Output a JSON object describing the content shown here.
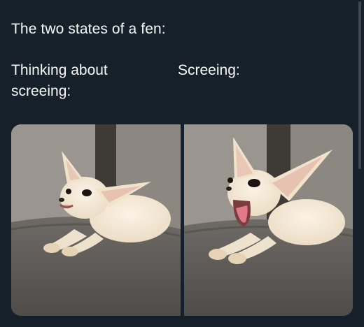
{
  "post": {
    "text": "The two states of a fen:",
    "captions": {
      "left": "Thinking about screeing:",
      "right": "Screeing:"
    }
  },
  "colors": {
    "background": "#15202b",
    "text": "#f7f9f9"
  }
}
